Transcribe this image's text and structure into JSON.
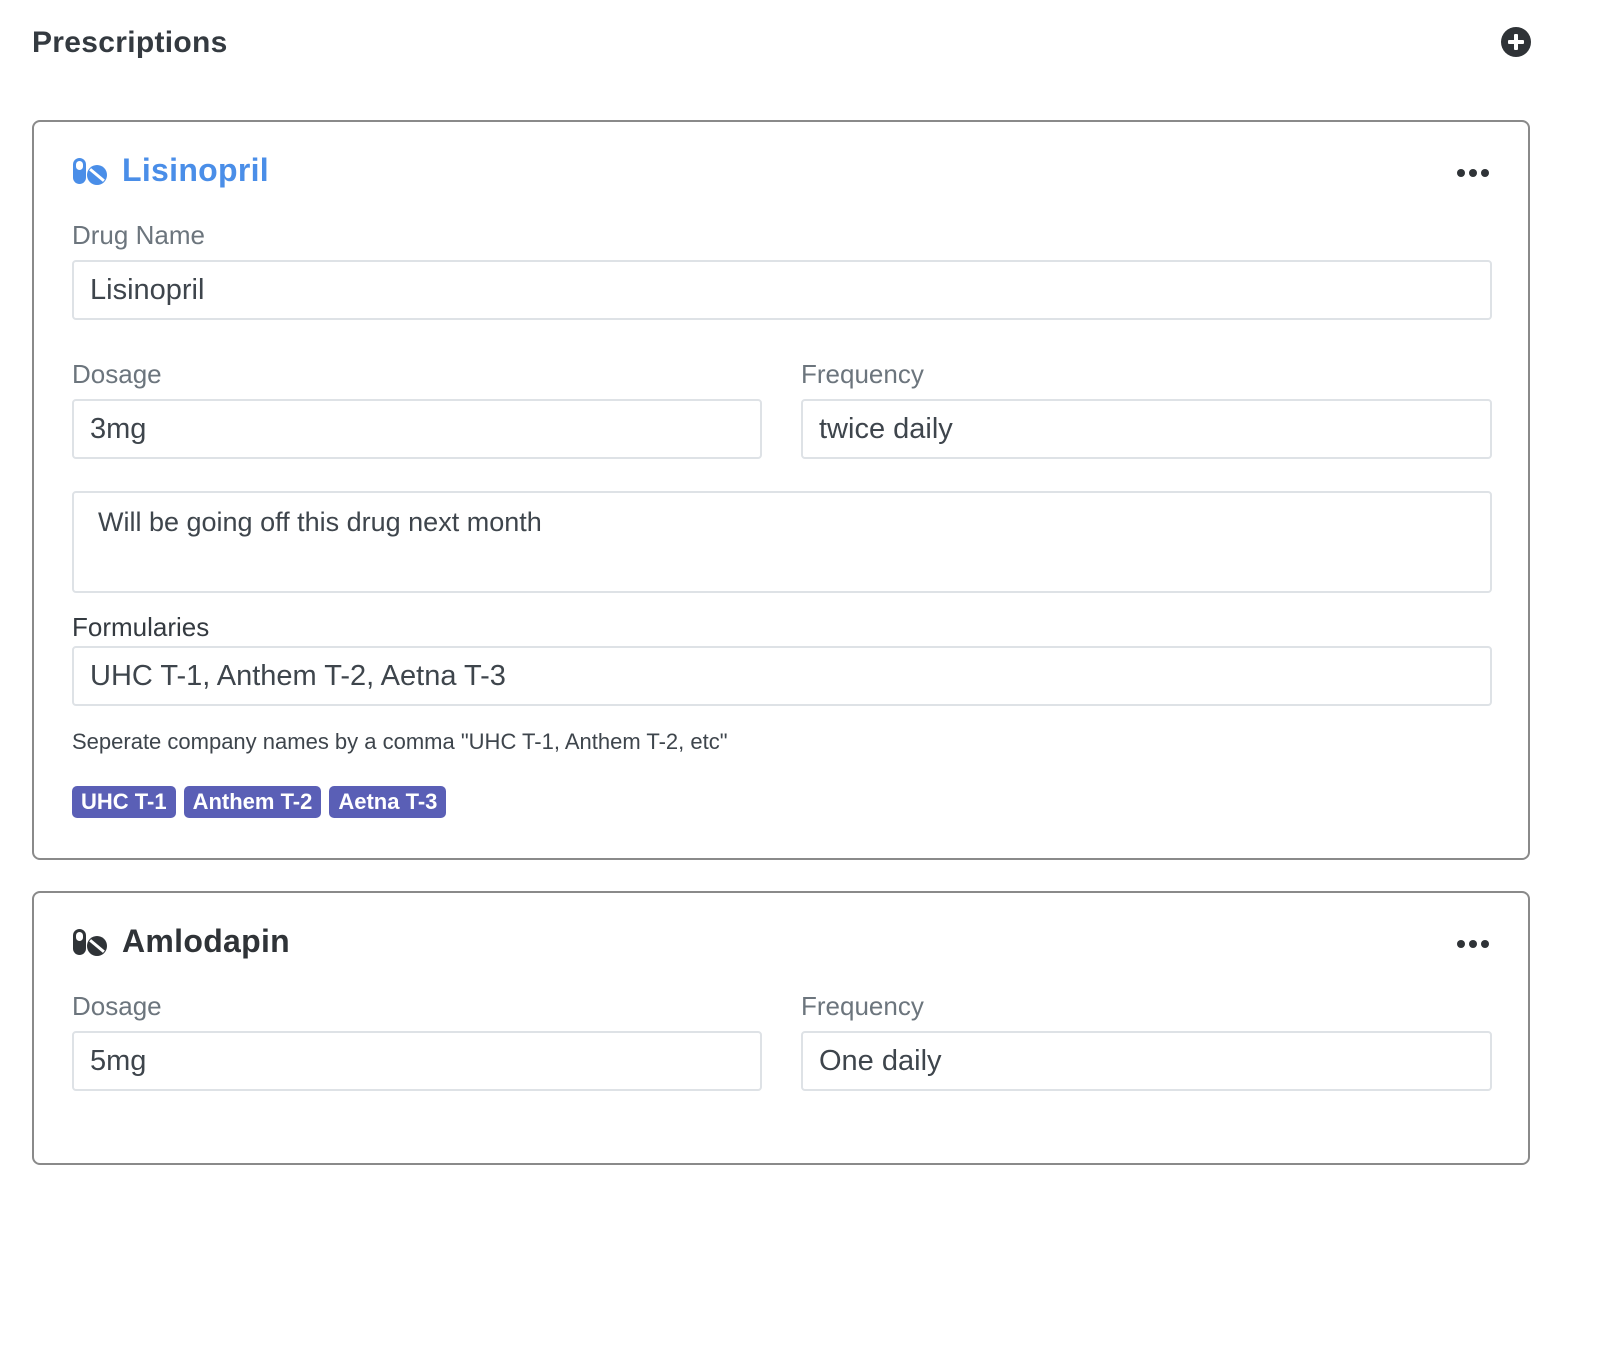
{
  "page": {
    "title": "Prescriptions",
    "add_icon": "plus-circle-icon"
  },
  "prescriptions": [
    {
      "name": "Lisinopril",
      "name_color": "#4a8ee8",
      "icon": "pills-icon",
      "menu_icon": "ellipsis-icon",
      "drug_name_label": "Drug Name",
      "drug_name_value": "Lisinopril",
      "dosage_label": "Dosage",
      "dosage_value": "3mg",
      "frequency_label": "Frequency",
      "frequency_value": "twice daily",
      "notes_value": "Will be going off this drug next month",
      "formularies_label": "Formularies",
      "formularies_value": "UHC T-1, Anthem T-2, Aetna T-3",
      "formularies_help": "Seperate company names by a comma \"UHC T-1, Anthem T-2, etc\"",
      "formulary_tags": [
        "UHC T-1",
        "Anthem T-2",
        "Aetna T-3"
      ]
    },
    {
      "name": "Amlodapin",
      "name_color": "#2f3337",
      "icon": "pills-icon",
      "menu_icon": "ellipsis-icon",
      "dosage_label": "Dosage",
      "dosage_value": "5mg",
      "frequency_label": "Frequency",
      "frequency_value": "One daily"
    }
  ],
  "colors": {
    "accent": "#4a8ee8",
    "badge": "#5a5fb6",
    "text": "#343a40",
    "muted": "#6c757d"
  }
}
